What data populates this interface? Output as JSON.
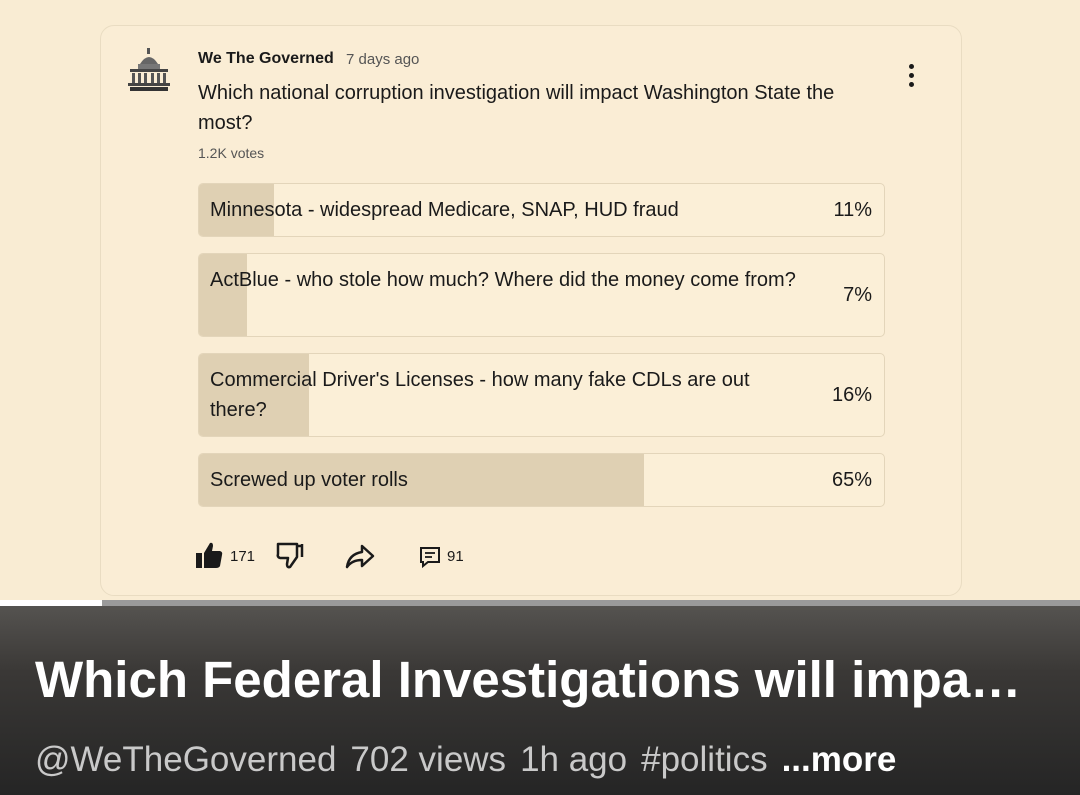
{
  "post": {
    "channel": "We The Governed",
    "age": "7 days ago",
    "question": "Which national corruption investigation will impact Washington State the most?",
    "votes": "1.2K votes",
    "options": [
      {
        "label": "Minnesota - widespread Medicare, SNAP, HUD fraud",
        "pct": "11%",
        "share": 0.11
      },
      {
        "label": "ActBlue - who stole how much? Where did the money come from?",
        "pct": "7%",
        "share": 0.07
      },
      {
        "label": "Commercial Driver's Licenses - how many fake CDLs are out there?",
        "pct": "16%",
        "share": 0.16
      },
      {
        "label": "Screwed up voter rolls",
        "pct": "65%",
        "share": 0.65
      }
    ],
    "likes": "171",
    "comments": "91"
  },
  "video": {
    "title": "Which Federal Investigations will impa…",
    "handle": "@WeTheGoverned",
    "views": "702 views",
    "posted": "1h ago",
    "tag": "#politics",
    "more": "...more",
    "progress": 0.094
  },
  "icons": {
    "avatar": "capitol-building-logo",
    "menu": "more-vert-icon",
    "like": "thumbs-up-filled-icon",
    "dislike": "thumbs-down-outline-icon",
    "share": "share-arrow-icon",
    "comment": "comment-bubble-icon"
  },
  "colors": {
    "background": "#f9ecd3",
    "bar_fill": "#dfd0b3",
    "progress": "#ffffff"
  }
}
